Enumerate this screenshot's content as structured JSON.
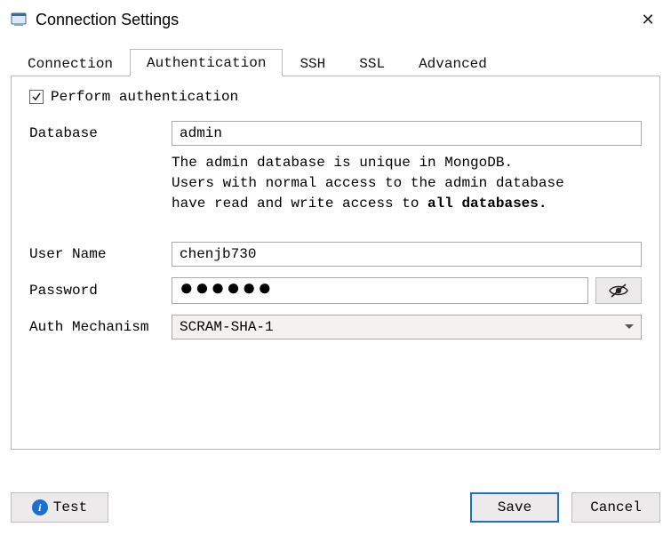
{
  "window": {
    "title": "Connection Settings",
    "close_glyph": "✕"
  },
  "tabs": {
    "connection": "Connection",
    "authentication": "Authentication",
    "ssh": "SSH",
    "ssl": "SSL",
    "advanced": "Advanced",
    "active": "authentication"
  },
  "auth_panel": {
    "perform_label": "Perform authentication",
    "perform_checked": true,
    "database_label": "Database",
    "database_value": "admin",
    "help_line1": "The admin database is unique in MongoDB.",
    "help_line2": "Users with normal access to the admin database",
    "help_line3a": "have read and write access to ",
    "help_line3b_bold": "all databases.",
    "username_label": "User Name",
    "username_value": "chenjb730",
    "password_label": "Password",
    "password_masked": "●●●●●●",
    "auth_mech_label": "Auth Mechanism",
    "auth_mech_value": "SCRAM-SHA-1"
  },
  "footer": {
    "test_label": "Test",
    "save_label": "Save",
    "cancel_label": "Cancel"
  }
}
